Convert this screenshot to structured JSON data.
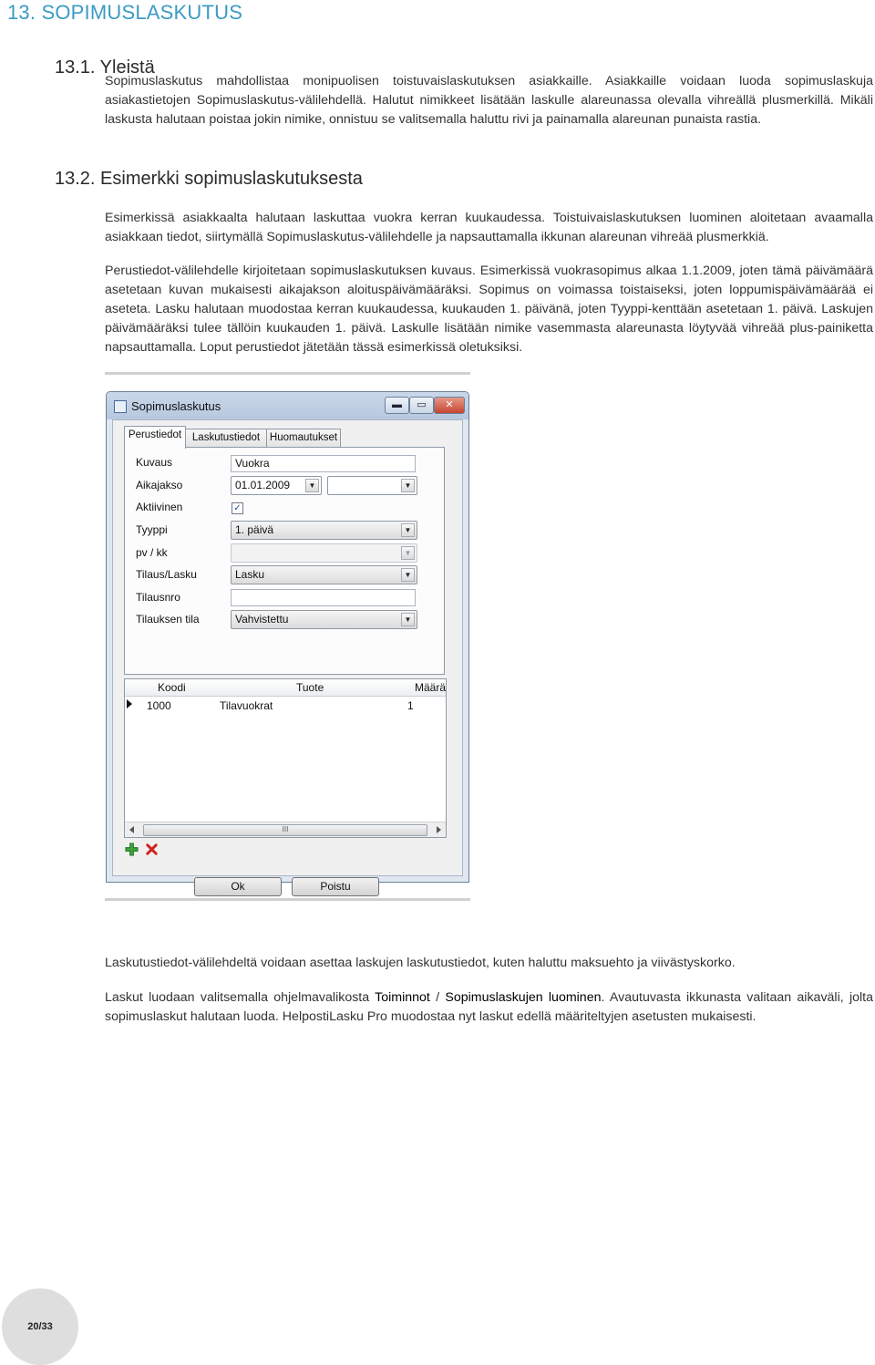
{
  "heading_main": "13. SOPIMUSLASKUTUS",
  "section1": {
    "title": "13.1. Yleistä",
    "paragraph": "Sopimuslaskutus mahdollistaa monipuolisen toistuvaislaskutuksen asiakkaille. Asiakkaille voidaan luoda sopimuslaskuja asiakastietojen Sopimuslaskutus-välilehdellä. Halutut nimikkeet lisätään laskulle alareunassa olevalla vihreällä plusmerkillä. Mikäli laskusta halutaan poistaa jokin nimike, onnistuu se valitsemalla haluttu rivi ja painamalla alareunan punaista rastia."
  },
  "section2": {
    "title": "13.2. Esimerkki sopimuslaskutuksesta",
    "paragraph1": "Esimerkissä asiakkaalta halutaan laskuttaa vuokra kerran kuukaudessa. Toistuivaislaskutuksen luominen aloitetaan avaamalla asiakkaan tiedot, siirtymällä Sopimuslaskutus-välilehdelle ja napsauttamalla ikkunan alareunan vihreää plusmerkkiä.",
    "paragraph2": "Perustiedot-välilehdelle kirjoitetaan sopimuslaskutuksen kuvaus. Esimerkissä vuokrasopimus alkaa 1.1.2009, joten tämä päivämäärä asetetaan kuvan mukaisesti aikajakson aloituspäivämääräksi. Sopimus on voimassa toistaiseksi, joten loppumispäivämäärää ei aseteta. Lasku halutaan muodostaa kerran kuukaudessa, kuukauden 1. päivänä, joten Tyyppi-kenttään asetetaan 1. päivä. Laskujen päivämääräksi tulee tällöin kuukauden 1. päivä. Laskulle lisätään nimike vasemmasta alareunasta löytyvää vihreää plus-painiketta napsauttamalla. Loput perustiedot jätetään tässä esimerkissä oletuksiksi."
  },
  "dialog": {
    "title": "Sopimuslaskutus",
    "tabs": [
      "Perustiedot",
      "Laskutustiedot",
      "Huomautukset"
    ],
    "labels": {
      "kuvaus": "Kuvaus",
      "aikajakso": "Aikajakso",
      "aktiivinen": "Aktiivinen",
      "tyyppi": "Tyyppi",
      "pvkk": "pv / kk",
      "tilauslasku": "Tilaus/Lasku",
      "tilausnro": "Tilausnro",
      "tilauksen_tila": "Tilauksen tila"
    },
    "values": {
      "kuvaus": "Vuokra",
      "aikajakso_start": "01.01.2009",
      "aikajakso_end": "",
      "aktiivinen_checked": true,
      "tyyppi": "1. päivä",
      "pvkk": "",
      "tilauslasku": "Lasku",
      "tilausnro": "",
      "tilauksen_tila": "Vahvistettu"
    },
    "grid": {
      "columns": [
        "Koodi",
        "Tuote",
        "Määrä"
      ],
      "rows": [
        [
          "1000",
          "Tilavuokrat",
          "1"
        ]
      ],
      "scroll_thumb": "III"
    },
    "buttons": {
      "ok": "Ok",
      "cancel": "Poistu"
    },
    "window_buttons": {
      "minimize": "▬",
      "maximize": "▭",
      "close": "✕"
    },
    "checkmark": "✓",
    "dropdown_arrow": "▼",
    "icons": {
      "add": "plus-icon",
      "delete": "delete-icon"
    },
    "colors": {
      "add": "#3aa53a",
      "delete": "#d3231e"
    }
  },
  "section3": {
    "paragraph1": "Laskutustiedot-välilehdeltä voidaan asettaa laskujen laskutustiedot, kuten haluttu maksuehto ja viivästyskorko.",
    "p2_part1": "Laskut luodaan valitsemalla ohjelmavalikosta ",
    "p2_menu1": "Toiminnot",
    "p2_sep": " / ",
    "p2_menu2": "Sopimuslaskujen luominen",
    "p2_part2": ". Avautuvasta ikkunasta valitaan aikaväli, jolta sopimuslaskut halutaan luoda. HelpostiLasku Pro muodostaa nyt laskut edellä määriteltyjen asetusten mukaisesti."
  },
  "page_number": "20/33"
}
